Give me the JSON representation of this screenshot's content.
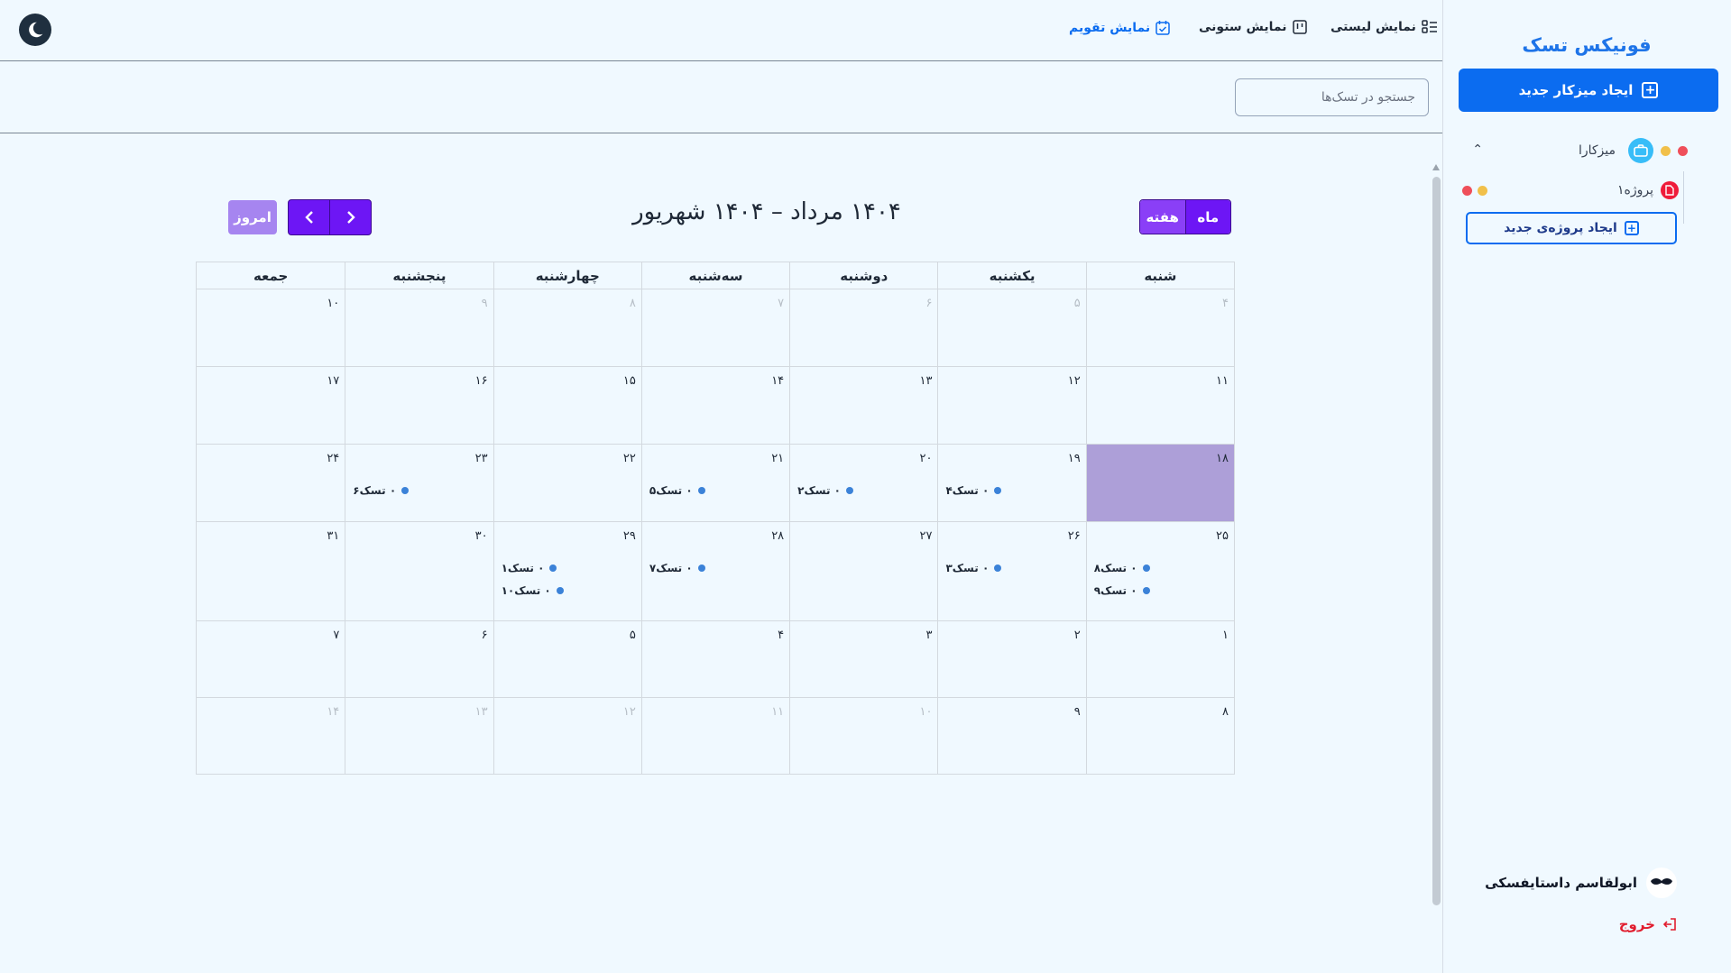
{
  "app": {
    "brand": "فونیکس تسک",
    "accent_color": "#0b6cf0",
    "calendar_button_color": "#6d16f5",
    "today_highlight_color": "#ad9fd8"
  },
  "sidebar": {
    "new_workspace_label": "ایجاد میزکار جدید",
    "workspace": {
      "label": "میزکارا",
      "icon": "briefcase-icon",
      "status_dots": [
        "#f1c04a",
        "#ef4f5a"
      ]
    },
    "project": {
      "label": "پروژه۱",
      "icon": "document-icon",
      "status_dots": [
        "#f1c04a",
        "#ef4f5a"
      ]
    },
    "new_project_label": "ایجاد پروژه‌ی جدید",
    "user_name": "ابولقاسم داستایفسکی",
    "logout_label": "خروج"
  },
  "topbar": {
    "views": [
      {
        "label": "نمایش لیستی",
        "icon": "list-icon",
        "active": false
      },
      {
        "label": "نمایش ستونی",
        "icon": "columns-icon",
        "active": false
      },
      {
        "label": "نمایش تقویم",
        "icon": "calendar-icon",
        "active": true
      }
    ],
    "theme_toggle_icon": "moon-icon"
  },
  "search": {
    "placeholder": "جستجو در تسک‌ها",
    "value": ""
  },
  "calendar": {
    "title": "۱۴۰۴ مرداد – ۱۴۰۴ شهریور",
    "today_label": "امروز",
    "view_month": "ماه",
    "view_week": "هفته",
    "active_view": "month",
    "weekdays": [
      "شنبه",
      "یکشنبه",
      "دوشنبه",
      "سه‌شنبه",
      "چهارشنبه",
      "پنجشنبه",
      "جمعه"
    ],
    "weeks": [
      [
        {
          "d": "۴",
          "other": true
        },
        {
          "d": "۵",
          "other": true
        },
        {
          "d": "۶",
          "other": true
        },
        {
          "d": "۷",
          "other": true
        },
        {
          "d": "۸",
          "other": true
        },
        {
          "d": "۹",
          "other": true
        },
        {
          "d": "۱۰"
        }
      ],
      [
        {
          "d": "۱۱"
        },
        {
          "d": "۱۲"
        },
        {
          "d": "۱۳"
        },
        {
          "d": "۱۴"
        },
        {
          "d": "۱۵"
        },
        {
          "d": "۱۶"
        },
        {
          "d": "۱۷"
        }
      ],
      [
        {
          "d": "۱۸",
          "today": true
        },
        {
          "d": "۱۹",
          "events": [
            "۰ تسک۴"
          ]
        },
        {
          "d": "۲۰",
          "events": [
            "۰ تسک۲"
          ]
        },
        {
          "d": "۲۱",
          "events": [
            "۰ تسک۵"
          ]
        },
        {
          "d": "۲۲"
        },
        {
          "d": "۲۳",
          "events": [
            "۰ تسک۶"
          ]
        },
        {
          "d": "۲۴"
        }
      ],
      [
        {
          "d": "۲۵",
          "events": [
            "۰ تسک۸",
            "۰ تسک۹"
          ]
        },
        {
          "d": "۲۶",
          "events": [
            "۰ تسک۳"
          ]
        },
        {
          "d": "۲۷"
        },
        {
          "d": "۲۸",
          "events": [
            "۰ تسک۷"
          ]
        },
        {
          "d": "۲۹",
          "events": [
            "۰ تسک۱",
            "۰ تسک۱۰"
          ]
        },
        {
          "d": "۳۰"
        },
        {
          "d": "۳۱"
        }
      ],
      [
        {
          "d": "۱"
        },
        {
          "d": "۲"
        },
        {
          "d": "۳"
        },
        {
          "d": "۴"
        },
        {
          "d": "۵"
        },
        {
          "d": "۶"
        },
        {
          "d": "۷"
        }
      ],
      [
        {
          "d": "۸"
        },
        {
          "d": "۹"
        },
        {
          "d": "۱۰",
          "other": true
        },
        {
          "d": "۱۱",
          "other": true
        },
        {
          "d": "۱۲",
          "other": true
        },
        {
          "d": "۱۳",
          "other": true
        },
        {
          "d": "۱۴",
          "other": true
        }
      ]
    ]
  }
}
